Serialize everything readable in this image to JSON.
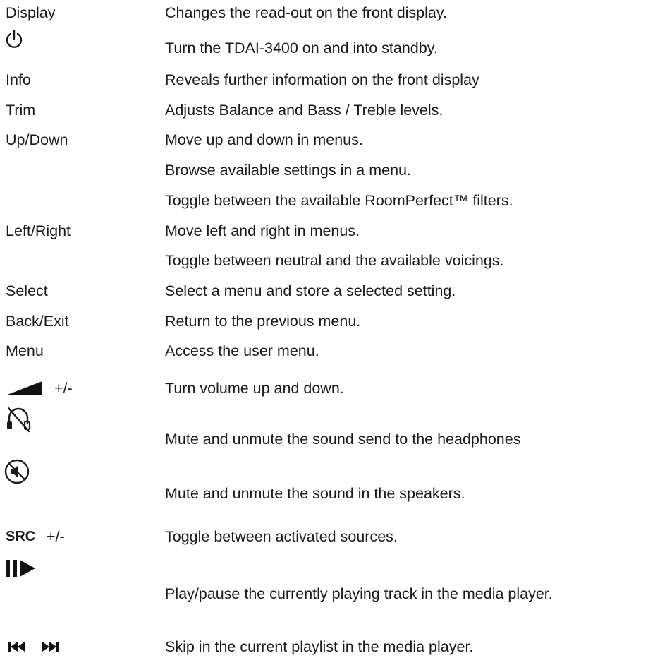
{
  "rows": [
    {
      "key": "Display",
      "desc": "Changes the read-out on the front display."
    },
    {
      "key": "",
      "icon": "power-icon",
      "desc": "Turn the TDAI-3400 on and into standby."
    },
    {
      "key": "Info",
      "desc": "Reveals further information on the front display"
    },
    {
      "key": "Trim",
      "desc": "Adjusts Balance and Bass / Treble levels."
    },
    {
      "key": "Up/Down",
      "desc": "Move up and down in menus."
    },
    {
      "key": "",
      "desc": "Browse available settings in a menu."
    },
    {
      "key": "",
      "desc": "Toggle between the available RoomPerfect™ filters."
    },
    {
      "key": "Left/Right",
      "desc": "Move left and right in menus."
    },
    {
      "key": "",
      "desc": "Toggle between neutral and the available voicings."
    },
    {
      "key": "Select",
      "desc": "Select a menu and store a selected setting."
    },
    {
      "key": "Back/Exit",
      "desc": "Return to the previous menu."
    },
    {
      "key": "Menu",
      "desc": "Access the user menu."
    },
    {
      "key": "+/-",
      "icon": "volume-ramp-icon",
      "desc": "Turn volume up and down."
    },
    {
      "key": "",
      "icon": "headphones-mute-icon",
      "desc": "Mute and unmute the sound send to the headphones"
    },
    {
      "key": "",
      "icon": "speaker-mute-icon",
      "desc": "Mute and unmute the sound in the speakers."
    },
    {
      "key": "SRC",
      "key_suffix": "+/-",
      "desc": "Toggle between activated sources."
    },
    {
      "key": "",
      "icon": "play-pause-icon",
      "desc": "Play/pause the currently playing track in the media player."
    },
    {
      "key": "",
      "icon": "skip-prev-next-icon",
      "desc": "Skip in the current playlist in the media player."
    }
  ]
}
